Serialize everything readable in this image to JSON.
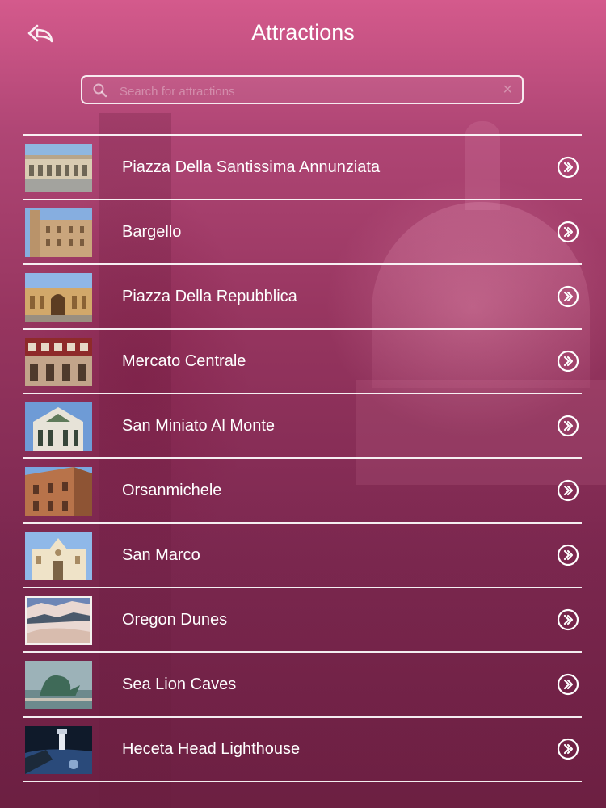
{
  "header": {
    "title": "Attractions",
    "back_icon": "back-arrow-icon"
  },
  "search": {
    "placeholder": "Search for attractions",
    "value": "",
    "search_icon": "magnifier-icon",
    "clear_icon": "clear-x-icon"
  },
  "attractions": [
    {
      "name": "Piazza Della Santissima Annunziata",
      "icon": "chevron-double-right-icon"
    },
    {
      "name": "Bargello",
      "icon": "chevron-double-right-icon"
    },
    {
      "name": "Piazza Della Repubblica",
      "icon": "chevron-double-right-icon"
    },
    {
      "name": "Mercato Centrale",
      "icon": "chevron-double-right-icon"
    },
    {
      "name": "San Miniato Al Monte",
      "icon": "chevron-double-right-icon"
    },
    {
      "name": "Orsanmichele",
      "icon": "chevron-double-right-icon"
    },
    {
      "name": "San Marco",
      "icon": "chevron-double-right-icon"
    },
    {
      "name": "Oregon Dunes",
      "icon": "chevron-double-right-icon"
    },
    {
      "name": "Sea Lion Caves",
      "icon": "chevron-double-right-icon"
    },
    {
      "name": "Heceta Head Lighthouse",
      "icon": "chevron-double-right-icon"
    }
  ],
  "colors": {
    "background_top": "#d45a8c",
    "background_bottom": "#6c2044",
    "text": "#ffffff",
    "divider": "#ffffff"
  }
}
